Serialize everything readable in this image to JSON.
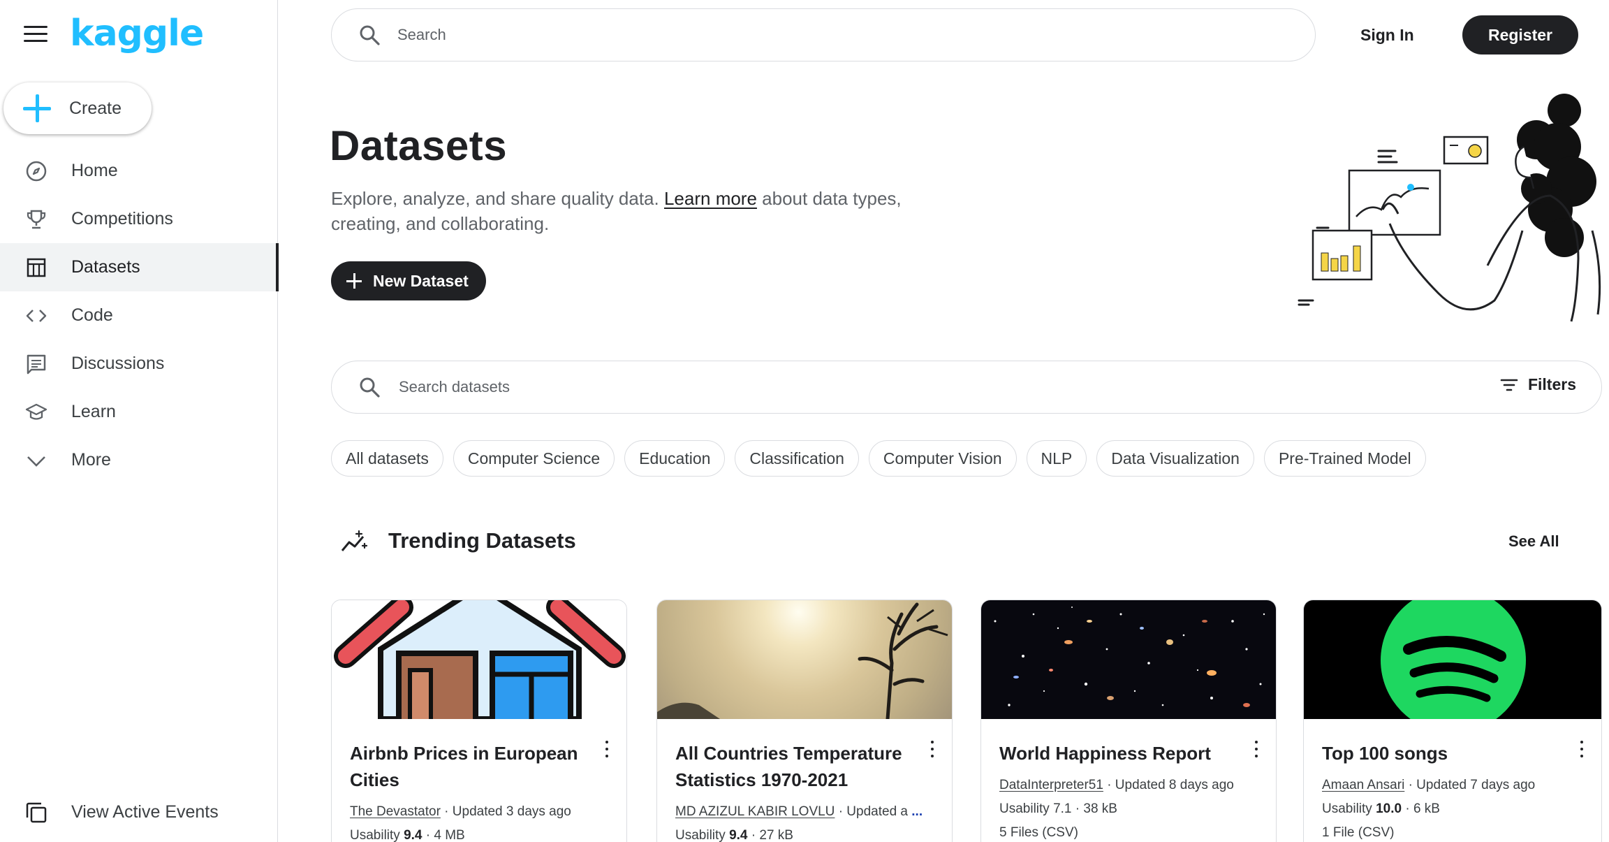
{
  "app": {
    "logo": "kaggle"
  },
  "sidebar": {
    "create_label": "Create",
    "items": [
      {
        "label": "Home",
        "icon": "compass-icon"
      },
      {
        "label": "Competitions",
        "icon": "trophy-icon"
      },
      {
        "label": "Datasets",
        "icon": "table-icon",
        "active": true
      },
      {
        "label": "Code",
        "icon": "code-icon"
      },
      {
        "label": "Discussions",
        "icon": "comment-icon"
      },
      {
        "label": "Learn",
        "icon": "graduation-cap-icon"
      },
      {
        "label": "More",
        "icon": "chevron-down-icon"
      }
    ],
    "view_active_events": "View Active Events"
  },
  "header": {
    "search_placeholder": "Search",
    "sign_in": "Sign In",
    "register": "Register"
  },
  "hero": {
    "title": "Datasets",
    "intro_before": "Explore, analyze, and share quality data. ",
    "intro_link": "Learn more",
    "intro_after": " about data types, creating, and collaborating.",
    "new_dataset": "New Dataset"
  },
  "dataset_search": {
    "placeholder": "Search datasets",
    "filters": "Filters"
  },
  "chips": [
    "All datasets",
    "Computer Science",
    "Education",
    "Classification",
    "Computer Vision",
    "NLP",
    "Data Visualization",
    "Pre-Trained Model"
  ],
  "trending": {
    "title": "Trending Datasets",
    "see_all": "See All",
    "cards": [
      {
        "title": "Airbnb Prices in European Cities",
        "author": "The Devastator",
        "updated": " · Updated 3 days ago",
        "usability_label": "Usability ",
        "usability": "9.4",
        "size": " · 4 MB",
        "files": ""
      },
      {
        "title": "All Countries Temperature Statistics 1970-2021",
        "author": "MD AZIZUL KABIR LOVLU",
        "updated": " · Updated a ",
        "ellipsis": "...",
        "usability_label": "Usability ",
        "usability": "9.4",
        "size": " · 27 kB",
        "files": ""
      },
      {
        "title": "World Happiness Report",
        "author": "DataInterpreter51",
        "updated": " · Updated 8 days ago",
        "usability_label": "Usability ",
        "usability": "7.1",
        "size": " · 38 kB",
        "files": "5 Files (CSV)"
      },
      {
        "title": "Top 100 songs",
        "author": "Amaan Ansari",
        "updated": " · Updated 7 days ago",
        "usability_label": "Usability ",
        "usability": "10.0",
        "size": " · 6 kB",
        "files": "1 File (CSV)"
      }
    ]
  },
  "colors": {
    "brand": "#20beff",
    "dark": "#202124",
    "border": "#dadce0",
    "spotify_green": "#1ed760"
  }
}
